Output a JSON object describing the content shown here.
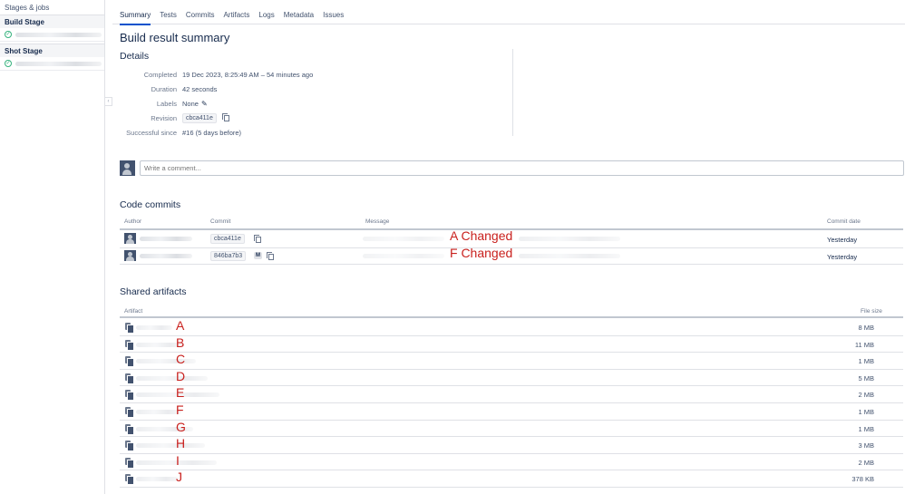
{
  "sidebar": {
    "title": "Stages & jobs",
    "stages": [
      {
        "name": "Build Stage"
      },
      {
        "name": "Shot Stage"
      }
    ]
  },
  "tabs": [
    "Summary",
    "Tests",
    "Commits",
    "Artifacts",
    "Logs",
    "Metadata",
    "Issues"
  ],
  "active_tab": "Summary",
  "page_title": "Build result summary",
  "details": {
    "title": "Details",
    "completed_label": "Completed",
    "completed_value": "19 Dec 2023, 8:25:49 AM – 54 minutes ago",
    "duration_label": "Duration",
    "duration_value": "42 seconds",
    "labels_label": "Labels",
    "labels_value": "None",
    "revision_label": "Revision",
    "revision_value": "cbca411e",
    "successful_label": "Successful since",
    "successful_value": "#16 (5 days before)"
  },
  "comment": {
    "placeholder": "Write a comment..."
  },
  "commits": {
    "title": "Code commits",
    "headers": {
      "author": "Author",
      "commit": "Commit",
      "message": "Message",
      "date": "Commit date"
    },
    "rows": [
      {
        "commit": "cbca411e",
        "annotation": "A Changed",
        "date": "Yesterday",
        "merge": ""
      },
      {
        "commit": "846ba7b3",
        "annotation": "F Changed",
        "date": "Yesterday",
        "merge": "M"
      }
    ]
  },
  "artifacts": {
    "title": "Shared artifacts",
    "headers": {
      "artifact": "Artifact",
      "size": "File size"
    },
    "rows": [
      {
        "letter": "A",
        "size": "8 MB"
      },
      {
        "letter": "B",
        "size": "11 MB"
      },
      {
        "letter": "C",
        "size": "1 MB"
      },
      {
        "letter": "D",
        "size": "5 MB"
      },
      {
        "letter": "E",
        "size": "2 MB"
      },
      {
        "letter": "F",
        "size": "1 MB"
      },
      {
        "letter": "G",
        "size": "1 MB"
      },
      {
        "letter": "H",
        "size": "3 MB"
      },
      {
        "letter": "I",
        "size": "2 MB"
      },
      {
        "letter": "J",
        "size": "378 KB"
      }
    ]
  },
  "colors": {
    "accent": "#0052cc",
    "annotation": "#c9211e",
    "success": "#36b37e"
  }
}
